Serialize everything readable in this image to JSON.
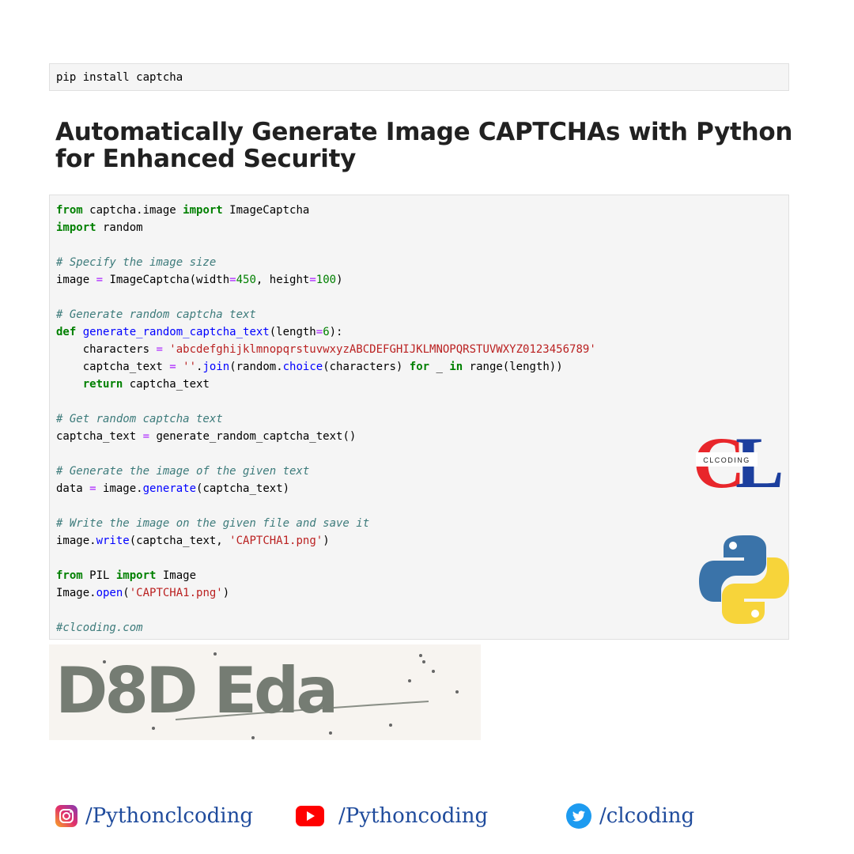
{
  "pip_cell": {
    "code": "pip install captcha"
  },
  "title": "Automatically Generate Image CAPTCHAs with Python for Enhanced Security",
  "code": {
    "l1_kw1": "from",
    "l1_mod": " captcha.image ",
    "l1_kw2": "import",
    "l1_name": " ImageCaptcha",
    "l2_kw": "import",
    "l2_name": " random",
    "c1": "# Specify the image size",
    "l4_a": "image ",
    "l4_op1": "=",
    "l4_b": " ImageCaptcha(width",
    "l4_op2": "=",
    "l4_n1": "450",
    "l4_c": ", height",
    "l4_op3": "=",
    "l4_n2": "100",
    "l4_d": ")",
    "c2": "# Generate random captcha text",
    "l6_kw": "def",
    "l6_fn": " generate_random_captcha_text",
    "l6_a": "(length",
    "l6_op": "=",
    "l6_n": "6",
    "l6_b": "):",
    "l7_a": "    characters ",
    "l7_op": "=",
    "l7_st": " 'abcdefghijklmnopqrstuvwxyzABCDEFGHIJKLMNOPQRSTUVWXYZ0123456789'",
    "l8_a": "    captcha_text ",
    "l8_op": "=",
    "l8_st": " ''",
    "l8_b": ".",
    "l8_fn1": "join",
    "l8_c": "(random.",
    "l8_fn2": "choice",
    "l8_d": "(characters) ",
    "l8_kw1": "for",
    "l8_e": " _ ",
    "l8_kw2": "in",
    "l8_f": " range(length))",
    "l9_ind": "    ",
    "l9_kw": "return",
    "l9_a": " captcha_text",
    "c3": "# Get random captcha text",
    "l11_a": "captcha_text ",
    "l11_op": "=",
    "l11_b": " generate_random_captcha_text()",
    "c4": "# Generate the image of the given text",
    "l13_a": "data ",
    "l13_op": "=",
    "l13_b": " image.",
    "l13_fn": "generate",
    "l13_c": "(captcha_text)",
    "c5": "# Write the image on the given file and save it",
    "l15_a": "image.",
    "l15_fn": "write",
    "l15_b": "(captcha_text, ",
    "l15_st": "'CAPTCHA1.png'",
    "l15_c": ")",
    "l16_kw1": "from",
    "l16_a": " PIL ",
    "l16_kw2": "import",
    "l16_b": " Image",
    "l17_a": "Image.",
    "l17_fn": "open",
    "l17_b": "(",
    "l17_st": "'CAPTCHA1.png'",
    "l17_c": ")",
    "c6": "#clcoding.com"
  },
  "logos": {
    "clcoding_text": "CLCODING",
    "clcoding_letters": "CL"
  },
  "captcha_output": {
    "text": "D8D Eda"
  },
  "social": {
    "instagram": "/Pythonclcoding",
    "youtube": "/Pythoncoding",
    "twitter": "/clcoding"
  },
  "colors": {
    "keyword": "#008000",
    "comment": "#3d7b7b",
    "string": "#ba2121",
    "function": "#0000ff",
    "operator": "#aa22ff",
    "social_text": "#1f4b9c"
  }
}
